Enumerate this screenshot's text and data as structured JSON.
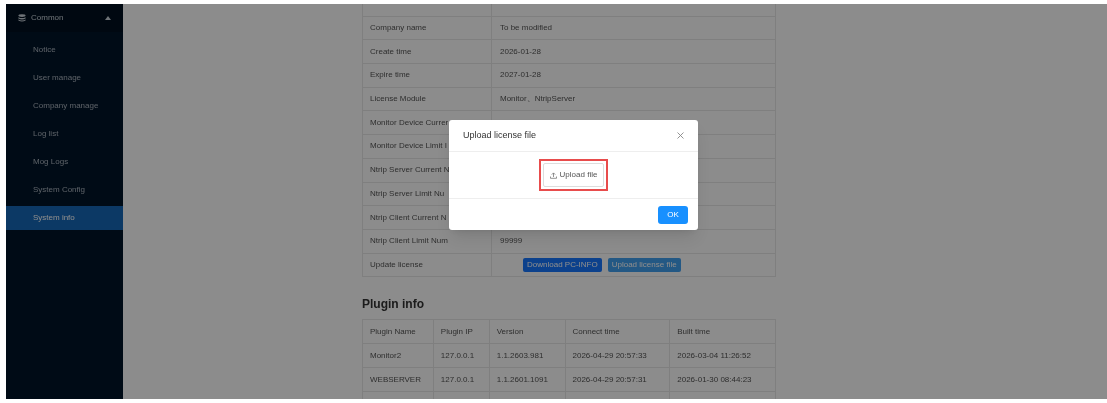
{
  "sidebar": {
    "group": {
      "label": "Common",
      "expanded": true
    },
    "items": [
      {
        "label": "Notice",
        "selected": false
      },
      {
        "label": "User manage",
        "selected": false
      },
      {
        "label": "Company manage",
        "selected": false
      },
      {
        "label": "Log list",
        "selected": false
      },
      {
        "label": "Mog Logs",
        "selected": false
      },
      {
        "label": "System Config",
        "selected": false
      },
      {
        "label": "System info",
        "selected": true
      }
    ]
  },
  "license_table": {
    "rows": [
      {
        "label": "Company name",
        "value": "To be modified"
      },
      {
        "label": "Create time",
        "value": "2026-01-28"
      },
      {
        "label": "Expire time",
        "value": "2027-01-28"
      },
      {
        "label": "License Module",
        "value": "Monitor、NtripServer"
      },
      {
        "label": "Monitor Device Currer"
      },
      {
        "label": "Monitor Device Limit I"
      },
      {
        "label": "Ntrip Server Current N"
      },
      {
        "label": "Ntrip Server Limit Nu"
      },
      {
        "label": "Ntrip Client Current N"
      },
      {
        "label": "Ntrip Client Limit Num",
        "value": "99999"
      },
      {
        "label": "Update license",
        "buttons": [
          "Download PC-INFO",
          "Upload license file"
        ]
      }
    ]
  },
  "plugin_info": {
    "title": "Plugin info",
    "columns": [
      "Plugin Name",
      "Plugin IP",
      "Version",
      "Connect time",
      "Built time"
    ],
    "rows": [
      [
        "Monitor2",
        "127.0.0.1",
        "1.1.2603.981",
        "2026-04-29 20:57:33",
        "2026-03-04 11:26:52"
      ],
      [
        "WEBSERVER",
        "127.0.0.1",
        "1.1.2601.1091",
        "2026-04-29 20:57:31",
        "2026-01-30 08:44:23"
      ]
    ]
  },
  "dialog": {
    "title": "Upload license file",
    "upload_button": {
      "label": "Upload file",
      "highlighted": true
    },
    "ok_button": "OK"
  }
}
